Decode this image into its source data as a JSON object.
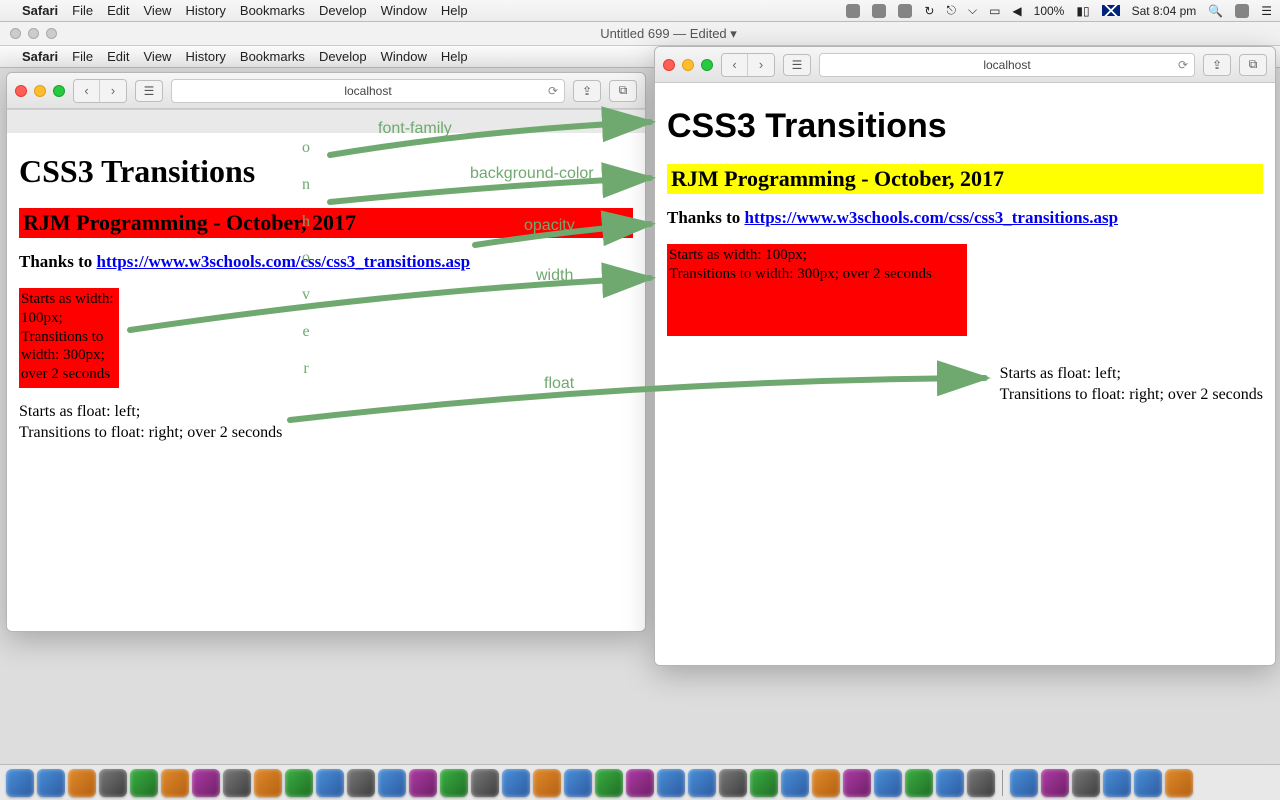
{
  "topbar": {
    "app": "Safari",
    "items": [
      "File",
      "Edit",
      "View",
      "History",
      "Bookmarks",
      "Develop",
      "Window",
      "Help"
    ],
    "battery": "100%",
    "time": "Sat 8:04 pm"
  },
  "editor": {
    "title": "Untitled 699 — Edited ▾"
  },
  "topbar2": {
    "app": "Safari",
    "items": [
      "File",
      "Edit",
      "View",
      "History",
      "Bookmarks",
      "Develop",
      "Window",
      "Help"
    ]
  },
  "leftWin": {
    "addr": "localhost",
    "h1": "CSS3 Transitions",
    "h2": "RJM Programming - October, 2017",
    "thanks_lead": "Thanks to ",
    "thanks_link": "https://www.w3schools.com/css/css3_transitions.asp",
    "box_l1": "Starts as width: 100px;",
    "box_l2": "Transitions to width: 300px; over 2 seconds",
    "float_l1": "Starts as float: left;",
    "float_l2": "Transitions to float: right; over 2 seconds"
  },
  "rightWin": {
    "addr": "localhost",
    "h1": "CSS3 Transitions",
    "h2": "RJM Programming - October, 2017",
    "thanks_lead": "Thanks to ",
    "thanks_link": "https://www.w3schools.com/css/css3_transitions.asp",
    "box_l1": "Starts as width: 100px;",
    "box_l2": "Transitions to width: 300px; over 2 seconds",
    "float_l1": "Starts as float: left;",
    "float_l2": "Transitions to float: right; over 2 seconds"
  },
  "annot": {
    "font_family": "font-family",
    "background_color": "background-color",
    "opacity": "opacity",
    "width": "width",
    "float": "float",
    "vert": [
      "o",
      "n",
      "h",
      "o",
      "v",
      "e",
      "r"
    ]
  }
}
